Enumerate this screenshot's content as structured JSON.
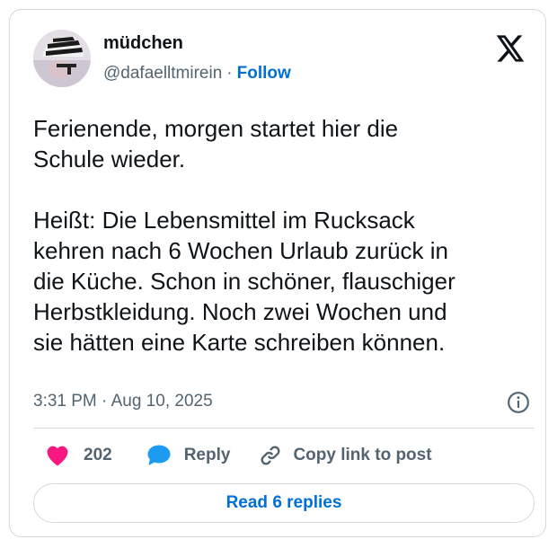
{
  "author": {
    "display_name": "müdchen",
    "handle": "@dafaelltmirein",
    "separator": "·",
    "follow_label": "Follow"
  },
  "tweet": {
    "text": "Ferienende, morgen startet hier die\nSchule wieder.\n\nHeißt: Die Lebensmittel im Rucksack\nkehren nach 6 Wochen Urlaub zurück in\ndie Küche. Schon in schöner, flauschiger\nHerbstkleidung. Noch zwei Wochen und\nsie hätten eine Karte schreiben können.",
    "timestamp": "3:31 PM · Aug 10, 2025"
  },
  "actions": {
    "like_count": "202",
    "reply_label": "Reply",
    "copy_link_label": "Copy link to post"
  },
  "read_replies_label": "Read 6 replies",
  "icons": {
    "brand": "x-logo",
    "info": "info-icon",
    "like": "heart-icon",
    "reply": "speech-bubble-icon",
    "copy": "link-icon"
  },
  "colors": {
    "text_primary": "#0f1419",
    "text_secondary": "#536471",
    "link_blue": "#006fd6",
    "heart_pink": "#f91880",
    "reply_blue": "#1d9bf0",
    "border": "#cfd9de"
  }
}
